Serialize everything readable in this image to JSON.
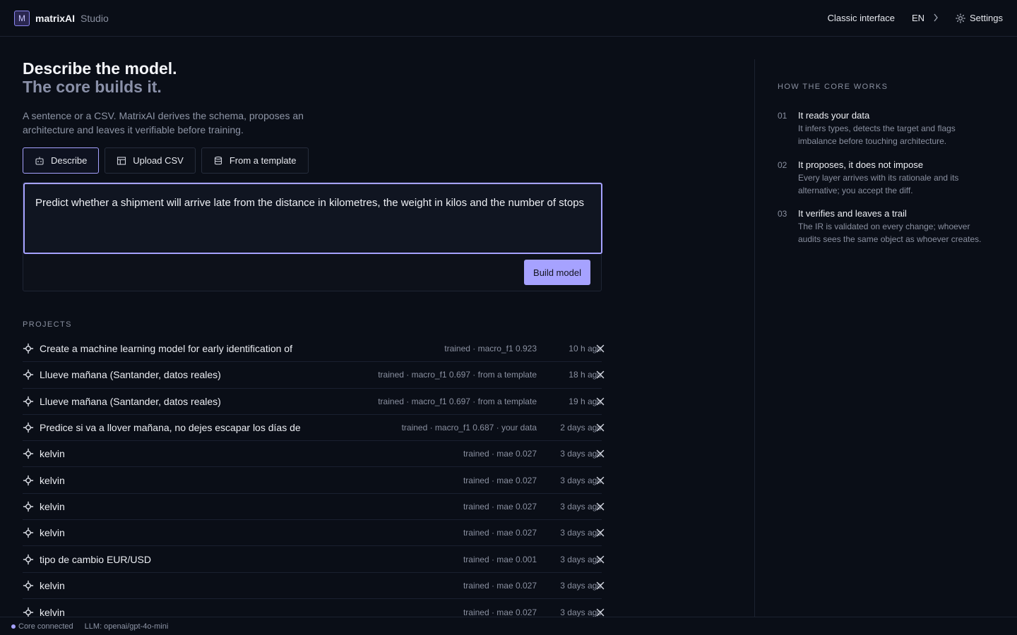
{
  "header": {
    "logo_letter": "M",
    "brand": "matrixAI",
    "brand_sub": "Studio",
    "classic_label": "Classic interface",
    "lang_label": "EN",
    "settings_label": "Settings"
  },
  "hero": {
    "title": "Describe the model.",
    "subtitle": "The core builds it.",
    "lede": "A sentence or a CSV. MatrixAI derives the schema, proposes an architecture and leaves it verifiable before training."
  },
  "tabs": [
    {
      "label": "Describe",
      "icon": "robot-icon",
      "active": true
    },
    {
      "label": "Upload CSV",
      "icon": "table-icon",
      "active": false
    },
    {
      "label": "From a template",
      "icon": "database-icon",
      "active": false
    }
  ],
  "composer": {
    "value": "Predict whether a shipment will arrive late from the distance in kilometres, the weight in kilos and the number of stops",
    "build_label": "Build model"
  },
  "projects": {
    "label": "PROJECTS",
    "items": [
      {
        "name": "Create a machine learning model for early identification of",
        "meta": "trained · macro_f1 0.923",
        "time": "10 h ago"
      },
      {
        "name": "Llueve mañana (Santander, datos reales)",
        "meta": "trained · macro_f1 0.697 · from a template",
        "time": "18 h ago"
      },
      {
        "name": "Llueve mañana (Santander, datos reales)",
        "meta": "trained · macro_f1 0.697 · from a template",
        "time": "19 h ago"
      },
      {
        "name": "Predice si va a llover mañana, no dejes escapar los días de",
        "meta": "trained · macro_f1 0.687 · your data",
        "time": "2 days ago"
      },
      {
        "name": "kelvin",
        "meta": "trained · mae 0.027",
        "time": "3 days ago"
      },
      {
        "name": "kelvin",
        "meta": "trained · mae 0.027",
        "time": "3 days ago"
      },
      {
        "name": "kelvin",
        "meta": "trained · mae 0.027",
        "time": "3 days ago"
      },
      {
        "name": "kelvin",
        "meta": "trained · mae 0.027",
        "time": "3 days ago"
      },
      {
        "name": "tipo de cambio EUR/USD",
        "meta": "trained · mae 0.001",
        "time": "3 days ago"
      },
      {
        "name": "kelvin",
        "meta": "trained · mae 0.027",
        "time": "3 days ago"
      },
      {
        "name": "kelvin",
        "meta": "trained · mae 0.027",
        "time": "3 days ago"
      }
    ]
  },
  "side": {
    "title": "HOW THE CORE WORKS",
    "steps": [
      {
        "num": "01",
        "title": "It reads your data",
        "desc": "It infers types, detects the target and flags imbalance before touching architecture."
      },
      {
        "num": "02",
        "title": "It proposes, it does not impose",
        "desc": "Every layer arrives with its rationale and its alternative; you accept the diff."
      },
      {
        "num": "03",
        "title": "It verifies and leaves a trail",
        "desc": "The IR is validated on every change; whoever audits sees the same object as whoever creates."
      }
    ]
  },
  "status": {
    "connection": "Core connected",
    "llm": "LLM: openai/gpt-4o-mini"
  },
  "colors": {
    "accent": "#a6a2ff",
    "background": "#0a0e17"
  }
}
